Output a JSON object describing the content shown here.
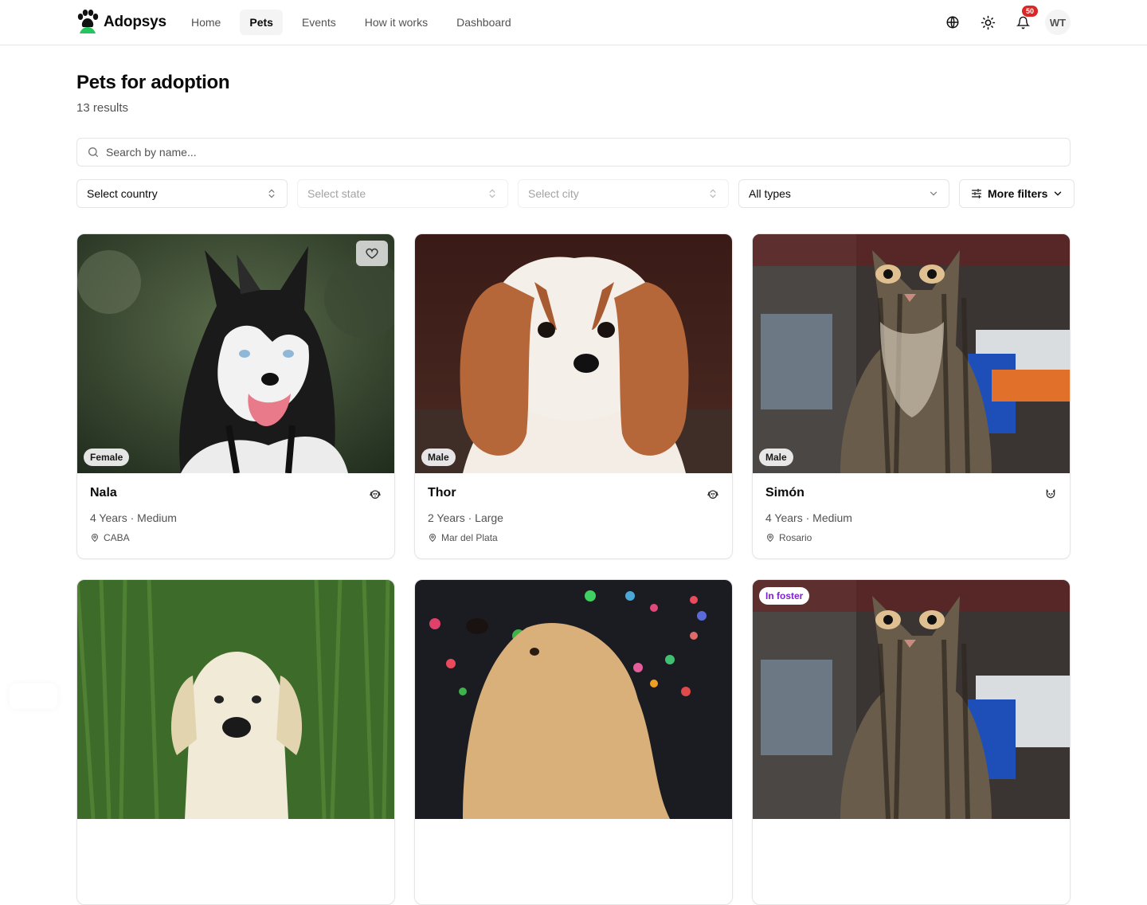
{
  "brand": {
    "name": "Adopsys",
    "accent": "#22c55e"
  },
  "nav": [
    {
      "label": "Home",
      "active": false
    },
    {
      "label": "Pets",
      "active": true
    },
    {
      "label": "Events",
      "active": false
    },
    {
      "label": "How it works",
      "active": false
    },
    {
      "label": "Dashboard",
      "active": false
    }
  ],
  "header": {
    "notifications_count": "50",
    "avatar_initials": "WT"
  },
  "page": {
    "title": "Pets for adoption",
    "results": "13 results"
  },
  "search": {
    "placeholder": "Search by name..."
  },
  "filters": {
    "country": "Select country",
    "state": "Select state",
    "city": "Select city",
    "type": "All types",
    "more": "More filters"
  },
  "pets": [
    {
      "name": "Nala",
      "gender": "Female",
      "details": "4 Years · Medium",
      "location": "CABA",
      "species_icon": "dog-icon"
    },
    {
      "name": "Thor",
      "gender": "Male",
      "details": "2 Years · Large",
      "location": "Mar del Plata",
      "species_icon": "dog-icon"
    },
    {
      "name": "Simón",
      "gender": "Male",
      "details": "4 Years · Medium",
      "location": "Rosario",
      "species_icon": "cat-icon"
    },
    {
      "name": "",
      "gender": "",
      "details": "",
      "location": ""
    },
    {
      "name": "",
      "gender": "",
      "details": "",
      "location": ""
    },
    {
      "name": "",
      "status": "In foster",
      "details": "",
      "location": ""
    }
  ]
}
